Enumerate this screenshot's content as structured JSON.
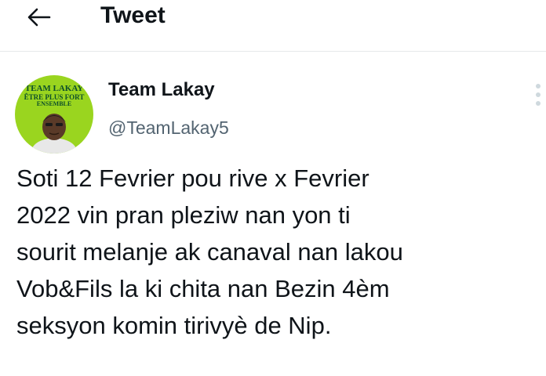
{
  "header": {
    "back_icon": "arrow-left-icon",
    "title": "Tweet"
  },
  "tweet": {
    "avatar": {
      "line1": "TEAM LAKAY",
      "line2": "ÊTRE PLUS FORT",
      "line3": "ENSEMBLE",
      "background_color": "#9ad51f"
    },
    "display_name": "Team Lakay",
    "handle": "@TeamLakay5",
    "more_icon": "more-vertical-icon",
    "text": "Soti 12 Fevrier pou rive x Fevrier\n2022 vin pran pleziw nan yon ti\nsourit melanje ak canaval nan lakou\nVob&Fils la ki chita nan Bezin 4èm\nseksyon komin tirivyè de Nip."
  }
}
